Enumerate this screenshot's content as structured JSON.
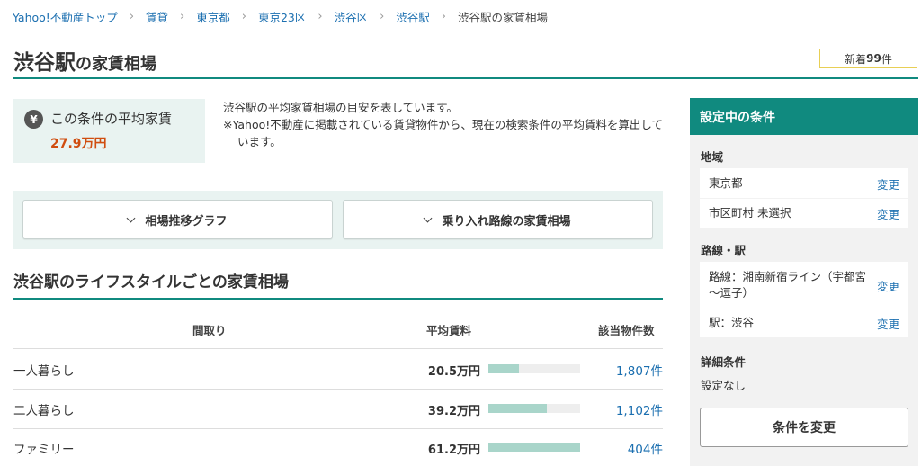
{
  "breadcrumb": {
    "items": [
      "Yahoo!不動産トップ",
      "賃貸",
      "東京都",
      "東京23区",
      "渋谷区",
      "渋谷駅"
    ],
    "current": "渋谷駅の家賃相場"
  },
  "header": {
    "title_main": "渋谷駅",
    "title_sub": "の家賃相場",
    "badge_prefix": "新着",
    "badge_count": "99",
    "badge_suffix": "件"
  },
  "average": {
    "label": "この条件の平均家賃",
    "value": "27.9万円"
  },
  "description": {
    "line1": "渋谷駅の平均家賃相場の目安を表しています。",
    "line2": "※Yahoo!不動産に掲載されている賃貸物件から、現在の検索条件の平均賃料を算出しています。"
  },
  "toggles": {
    "graph_label": "相場推移グラフ",
    "transfer_label": "乗り入れ路線の家賃相場"
  },
  "lifestyle": {
    "title": "渋谷駅のライフスタイルごとの家賃相場",
    "columns": {
      "layout": "間取り",
      "avg_rent": "平均賃料",
      "count": "該当物件数"
    },
    "rows": [
      {
        "label": "一人暮らし",
        "price": "20.5万円",
        "bar_fraction": 0.33,
        "count": "1,807件"
      },
      {
        "label": "二人暮らし",
        "price": "39.2万円",
        "bar_fraction": 0.64,
        "count": "1,102件"
      },
      {
        "label": "ファミリー",
        "price": "61.2万円",
        "bar_fraction": 1.0,
        "count": "404件"
      }
    ]
  },
  "sidebar": {
    "title": "設定中の条件",
    "region_heading": "地域",
    "prefecture": "東京都",
    "city": "市区町村 未選択",
    "line_heading": "路線・駅",
    "route": "路線：湘南新宿ライン（宇都宮～逗子）",
    "station": "駅：渋谷",
    "detail_heading": "詳細条件",
    "detail_value": "設定なし",
    "change_label": "変更",
    "change_conditions_button": "条件を変更"
  },
  "colors": {
    "accent": "#108a7f",
    "link": "#1b6fb0",
    "price_highlight": "#d04d0f",
    "bar_fill": "#a9d5ca",
    "panel_bg": "#e9f3f1"
  },
  "icons": {
    "yen": "yen-icon",
    "chevron": "chevron-down-icon",
    "separator": "chevron-right-icon"
  }
}
